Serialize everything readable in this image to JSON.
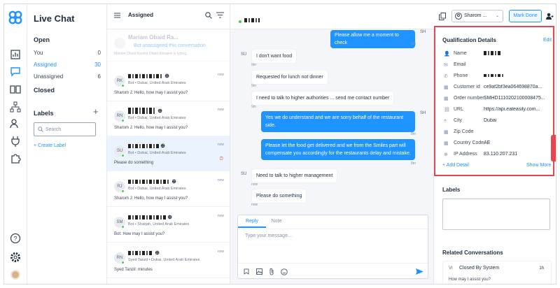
{
  "sidebar": {
    "title": "Live Chat",
    "open_label": "Open",
    "items": [
      {
        "label": "You",
        "count": "0"
      },
      {
        "label": "Assigned",
        "count": "30"
      },
      {
        "label": "Unassigned",
        "count": "6"
      }
    ],
    "closed_label": "Closed",
    "labels_title": "Labels",
    "search_placeholder": "Search",
    "create_label": "+ Create Label"
  },
  "list": {
    "title": "Assigned",
    "banner_name": "Mariam Obaid Ra...",
    "banner_text": "Bot unassigned this conversation",
    "banner_sub": "Mariam Obaid Rashid Obaid Alnuaimi is typing...",
    "cards": [
      {
        "initials": "RK",
        "loc": "Bot • Dubai, United Arab Emirates",
        "msg": "Sharom J: Hello, how may I assist you?",
        "time": "now"
      },
      {
        "initials": "RN",
        "loc": "Bot • Dubai, United Arab Emirates",
        "msg": "Sharom J: Hello, how may I assist you?",
        "time": "now"
      },
      {
        "initials": "SU",
        "loc": "Bot • Dubai, United Arab Emirates",
        "msg": "Please do something",
        "time": "now"
      },
      {
        "initials": "RJ",
        "loc": "Bot • Dubai, United Arab Emirates",
        "msg": "Sharom J: Hello, how may I assist you?",
        "time": "now"
      },
      {
        "initials": "SM",
        "loc": "Bot • Sharjah, United Arab Emirates",
        "msg": "Bot: How may I assist you?",
        "time": "now"
      },
      {
        "initials": "RN",
        "loc": "Syed Tanzil • Dubai, United Arab Emirates",
        "msg": "Syed Tanzil: minutes",
        "time": "now"
      }
    ]
  },
  "chat": {
    "header_user": "Sharom ...",
    "mark_done": "Mark Done",
    "messages": [
      {
        "dir": "out",
        "text": "Please allow me a moment to check",
        "time": "9m",
        "avatar": "SH"
      },
      {
        "dir": "in",
        "text": "I don't want food",
        "time": "9m",
        "avatar": "SU"
      },
      {
        "dir": "in",
        "text": "Requested for lunch not dinner",
        "time": "9m"
      },
      {
        "dir": "in",
        "text": "I need to talk to higher authorities ... send me contact number",
        "time": "9m"
      },
      {
        "dir": "out",
        "text": "Yes we do understand and we are sorry behalf of the restaurant side.",
        "time": "8m",
        "avatar": "SH"
      },
      {
        "dir": "out",
        "text": "Please let the food get delivered and we from the Smiles part will compensate you accordingly for the restaurants delay and mistake.",
        "time": "8m"
      },
      {
        "dir": "in",
        "text": "Need to talk to higher management",
        "time": "now",
        "avatar": "SU"
      },
      {
        "dir": "in",
        "text": "Please do something",
        "time": "now"
      }
    ],
    "reply_tab": "Reply",
    "note_tab": "Note",
    "reply_placeholder": "Type your message..."
  },
  "details": {
    "title": "Qualification Details",
    "edit": "Edit",
    "rows": [
      {
        "label": "Name",
        "value": "",
        "icon": "user-icon"
      },
      {
        "label": "Email",
        "value": "",
        "icon": "mail-icon"
      },
      {
        "label": "Phone",
        "value": "",
        "icon": "phone-icon"
      },
      {
        "label": "Customer id",
        "value": "ce9af2bf3ea064698870a...",
        "icon": "id-icon"
      },
      {
        "label": "Order number",
        "value": "SMHD1110202100008475...",
        "icon": "order-icon"
      },
      {
        "label": "URL",
        "value": "https://api.eateasily.com...",
        "icon": "link-icon"
      },
      {
        "label": "City",
        "value": "Dubai",
        "icon": "pin-icon"
      },
      {
        "label": "Zip Code",
        "value": "",
        "icon": "zip-icon"
      },
      {
        "label": "Country Code",
        "value": "AE",
        "icon": "flag-icon"
      },
      {
        "label": "IP Address",
        "value": "83.110.207.231",
        "icon": "globe-icon"
      }
    ],
    "add_detail": "+ Add Detail",
    "show_more": "Show More",
    "labels_title": "Labels",
    "related_title": "Related Conversations",
    "related_initials": "VI",
    "related_name": "Closed By System",
    "related_time": "1h",
    "related_msg": "How may I assist you?"
  },
  "colors": {
    "accent": "#1f93ff",
    "highlight": "#e8454c"
  }
}
